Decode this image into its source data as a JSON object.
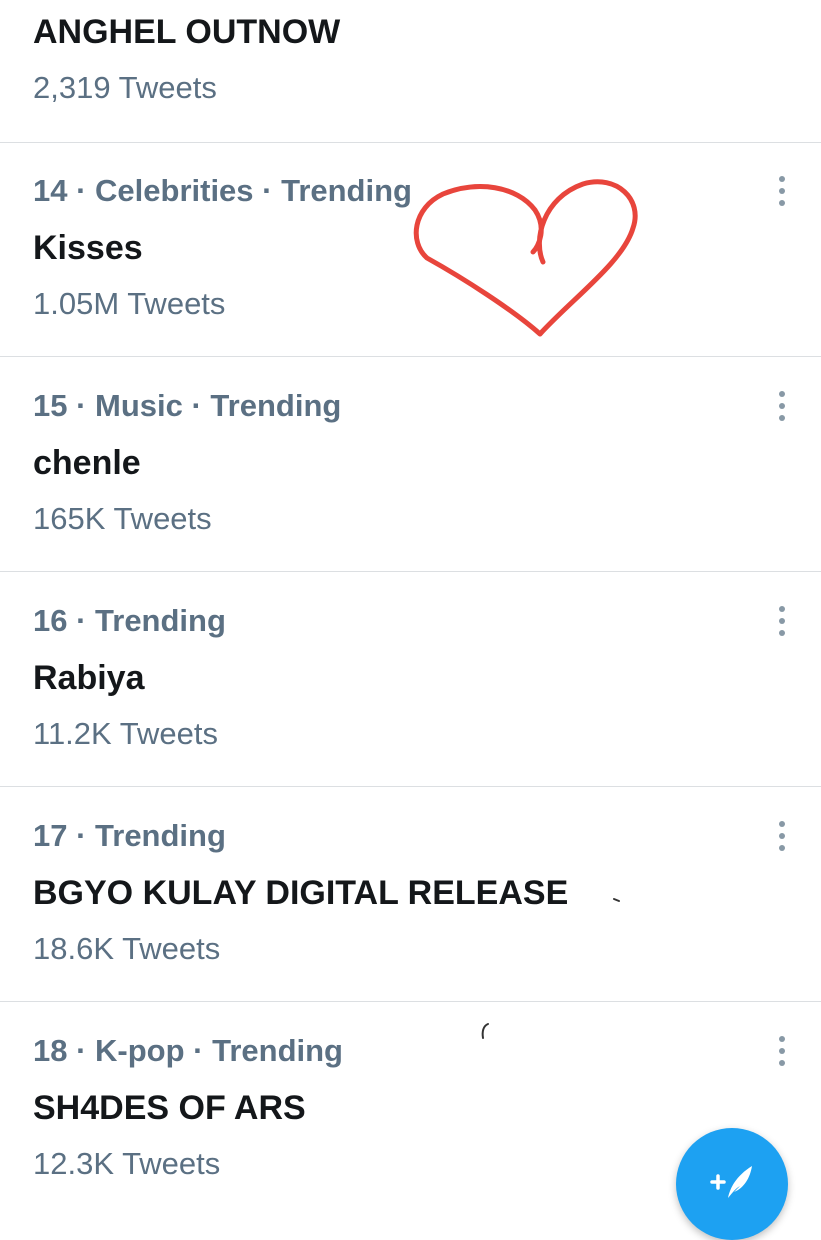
{
  "first_item": {
    "name": "ANGHEL OUTNOW",
    "count": "2,319 Tweets"
  },
  "trends": [
    {
      "meta": "14 · Celebrities · Trending",
      "name": "Kisses",
      "count": "1.05M Tweets"
    },
    {
      "meta": "15 · Music · Trending",
      "name": "chenle",
      "count": "165K Tweets"
    },
    {
      "meta": "16 · Trending",
      "name": "Rabiya",
      "count": "11.2K Tweets"
    },
    {
      "meta": "17 · Trending",
      "name": "BGYO KULAY DIGITAL RELEASE",
      "count": "18.6K Tweets"
    },
    {
      "meta": "18 · K-pop · Trending",
      "name": "SH4DES OF ARS",
      "count": "12.3K Tweets"
    }
  ],
  "icons": {
    "more": "more-vertical-icon",
    "compose": "compose-tweet-icon",
    "heart_drawing": "hand-drawn-heart"
  },
  "colors": {
    "accent": "#1da1f2",
    "secondary_text": "#5b7083",
    "primary_text": "#14171a",
    "annotation": "#e8453c"
  }
}
